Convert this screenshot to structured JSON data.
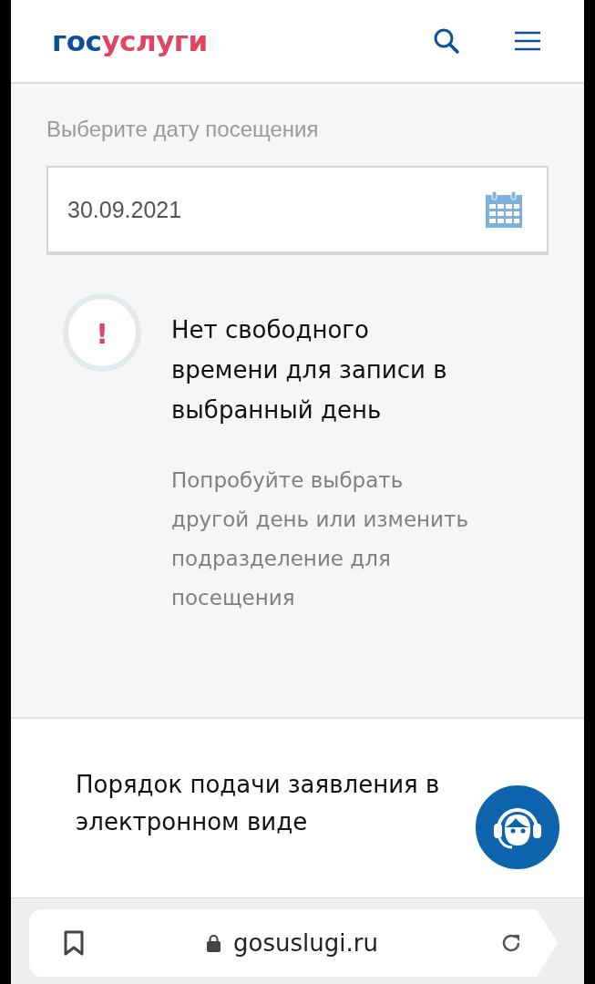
{
  "header": {
    "logo": {
      "first": "гос",
      "second": "услуги"
    }
  },
  "date_picker": {
    "label": "Выберите дату посещения",
    "value": "30.09.2021"
  },
  "notice": {
    "icon": "!",
    "title": "Нет свободного времени для записи в выбранный день",
    "text": "Попробуйте выбрать другой день или изменить подразделение для посещения"
  },
  "section": {
    "title": "Порядок подачи заявления в электронном виде"
  },
  "browser_bar": {
    "url": "gosuslugi.ru"
  }
}
